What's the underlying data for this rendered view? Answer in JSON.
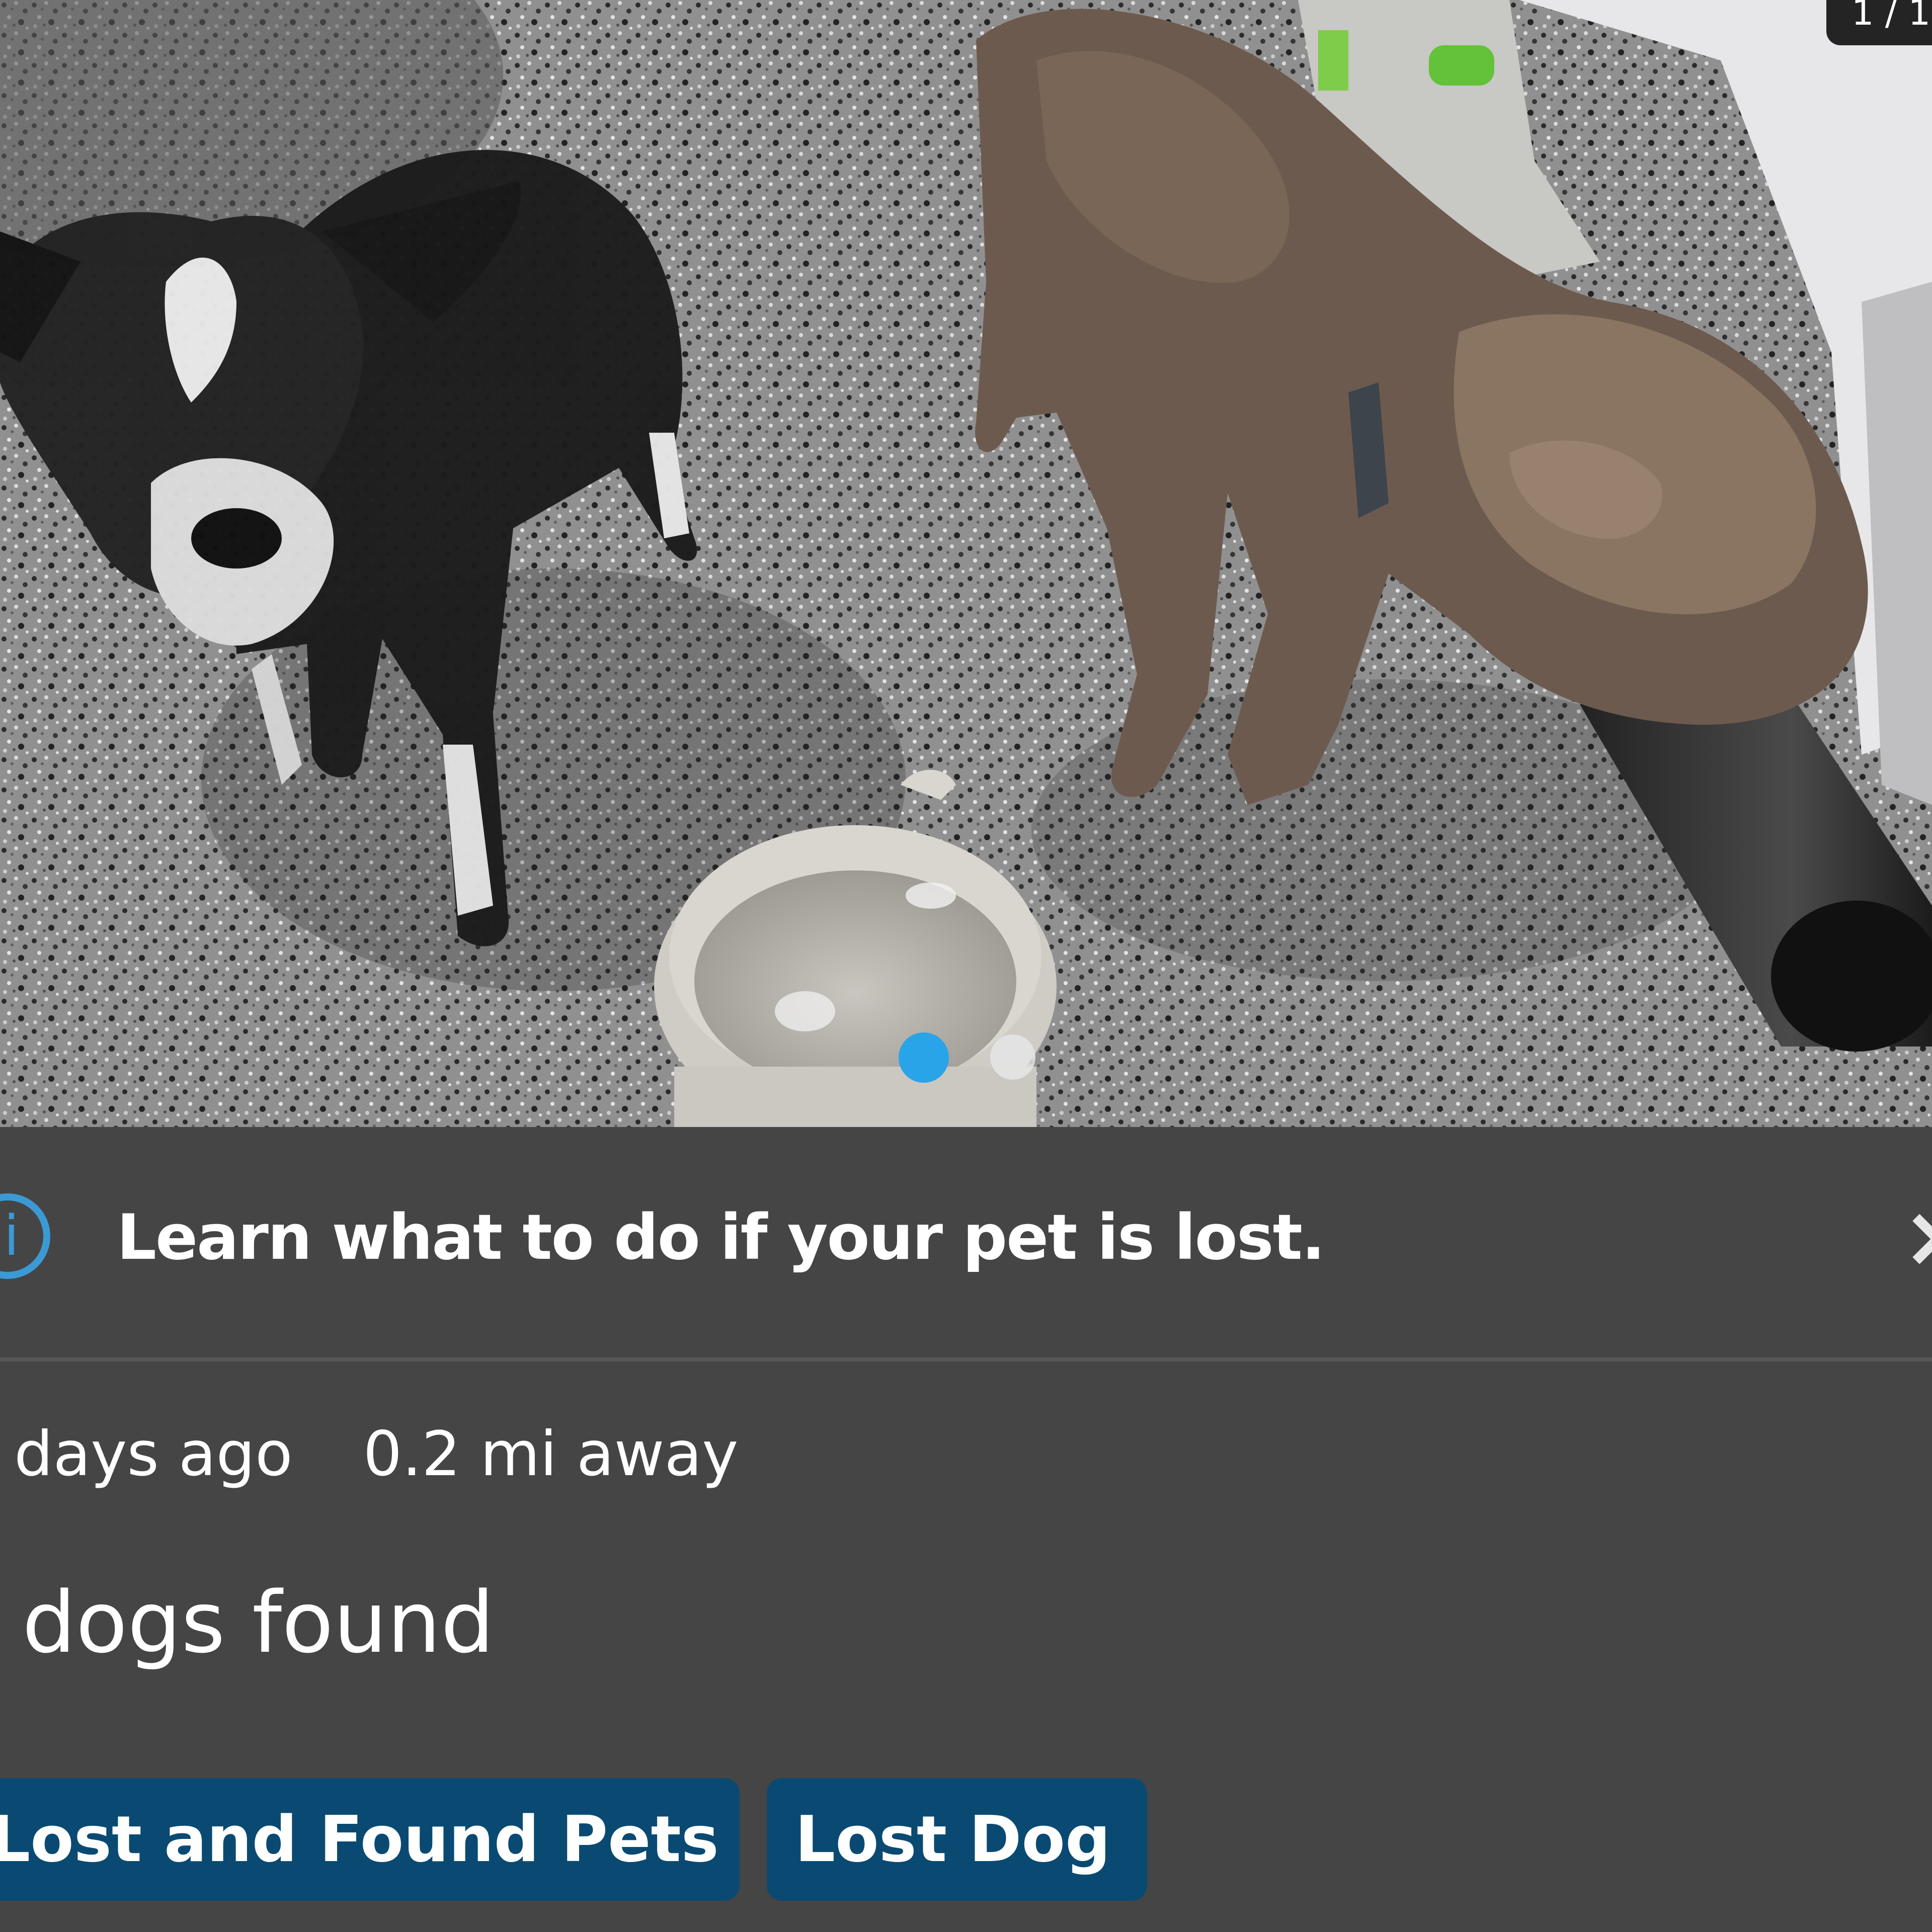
{
  "photo": {
    "counter": "1 / 1",
    "alt_description": ""
  },
  "banner": {
    "icon": "info-icon",
    "icon_glyph": "i",
    "text": "Learn what to do if your pet is lost.",
    "close_glyph": "×"
  },
  "post": {
    "time": "days ago",
    "distance": "0.2 mi away",
    "title": "dogs found"
  },
  "tags": [
    {
      "label": "Lost and Found Pets"
    },
    {
      "label": "Lost Dog"
    }
  ],
  "colors": {
    "background": "#454545",
    "tag": "#0a4a72",
    "accent": "#3b9ad4",
    "active_dot": "#2aa4e8"
  }
}
